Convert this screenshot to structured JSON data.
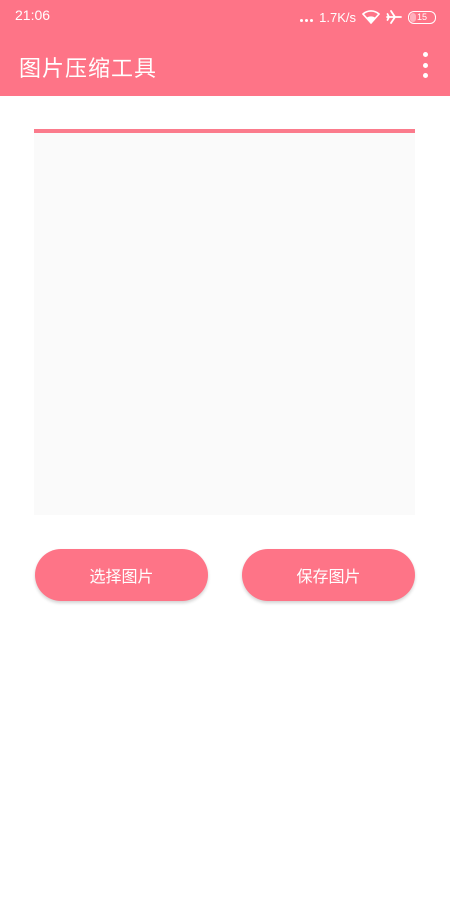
{
  "status_bar": {
    "time": "21:06",
    "network_speed": "1.7K/s",
    "battery_level": "15",
    "icons": [
      "signal-dots-icon",
      "wifi-icon",
      "airplane-icon",
      "battery-icon"
    ]
  },
  "app_bar": {
    "title": "图片压缩工具",
    "overflow_icon": "more-vert-icon"
  },
  "preview": {
    "progress_percent": 100
  },
  "actions": {
    "select_label": "选择图片",
    "save_label": "保存图片"
  },
  "colors": {
    "primary": "#fe7487",
    "progress": "#fb7b8c",
    "image_background": "#fafafa"
  }
}
